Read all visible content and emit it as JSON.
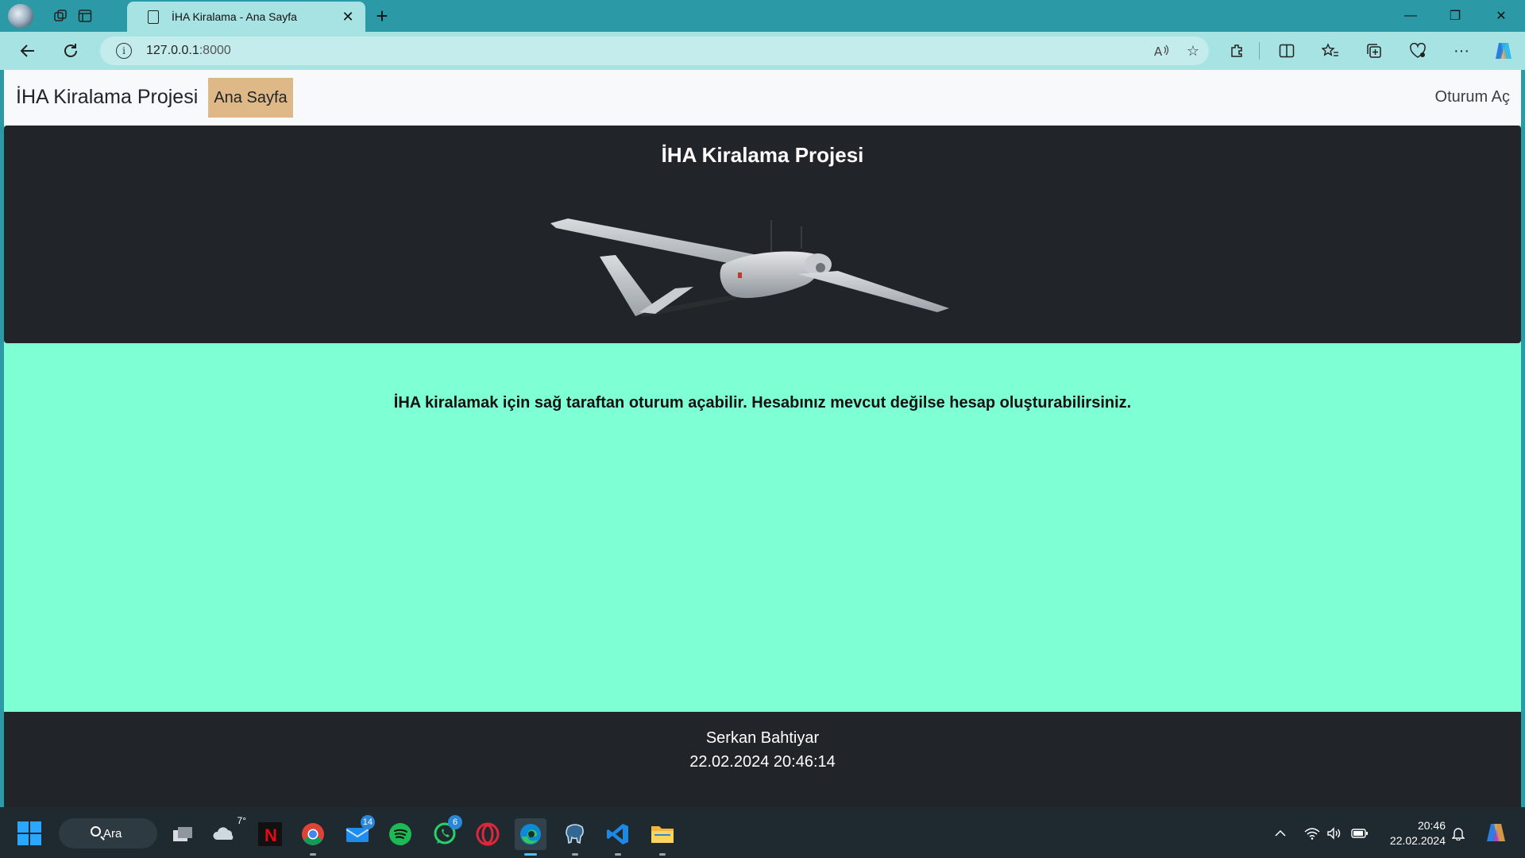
{
  "browser": {
    "tab_title": "İHA Kiralama - Ana Sayfa",
    "tab_close": "✕",
    "new_tab": "+",
    "url_host": "127.0.0.1",
    "url_port": ":8000",
    "window_min": "—",
    "window_restore": "❐",
    "window_close": "✕"
  },
  "site": {
    "brand": "İHA Kiralama Projesi",
    "nav_home": "Ana Sayfa",
    "nav_login": "Oturum Aç",
    "hero_title": "İHA Kiralama Projesi",
    "intro": "İHA kiralamak için sağ taraftan oturum açabilir. Hesabınız mevcut değilse hesap oluşturabilirsiniz.",
    "footer_author": "Serkan Bahtiyar",
    "footer_timestamp": "22.02.2024 20:46:14"
  },
  "taskbar": {
    "search_label": "Ara",
    "weather_temp": "7°",
    "mail_badge": "14",
    "whatsapp_badge": "6",
    "time": "20:46",
    "date": "22.02.2024"
  },
  "colors": {
    "page_bg": "#7fffd4",
    "navbar_bg": "#f8f9fa",
    "nav_active_bg": "#deb887",
    "dark_bg": "#212529",
    "browser_chrome": "#2b9aa6"
  }
}
